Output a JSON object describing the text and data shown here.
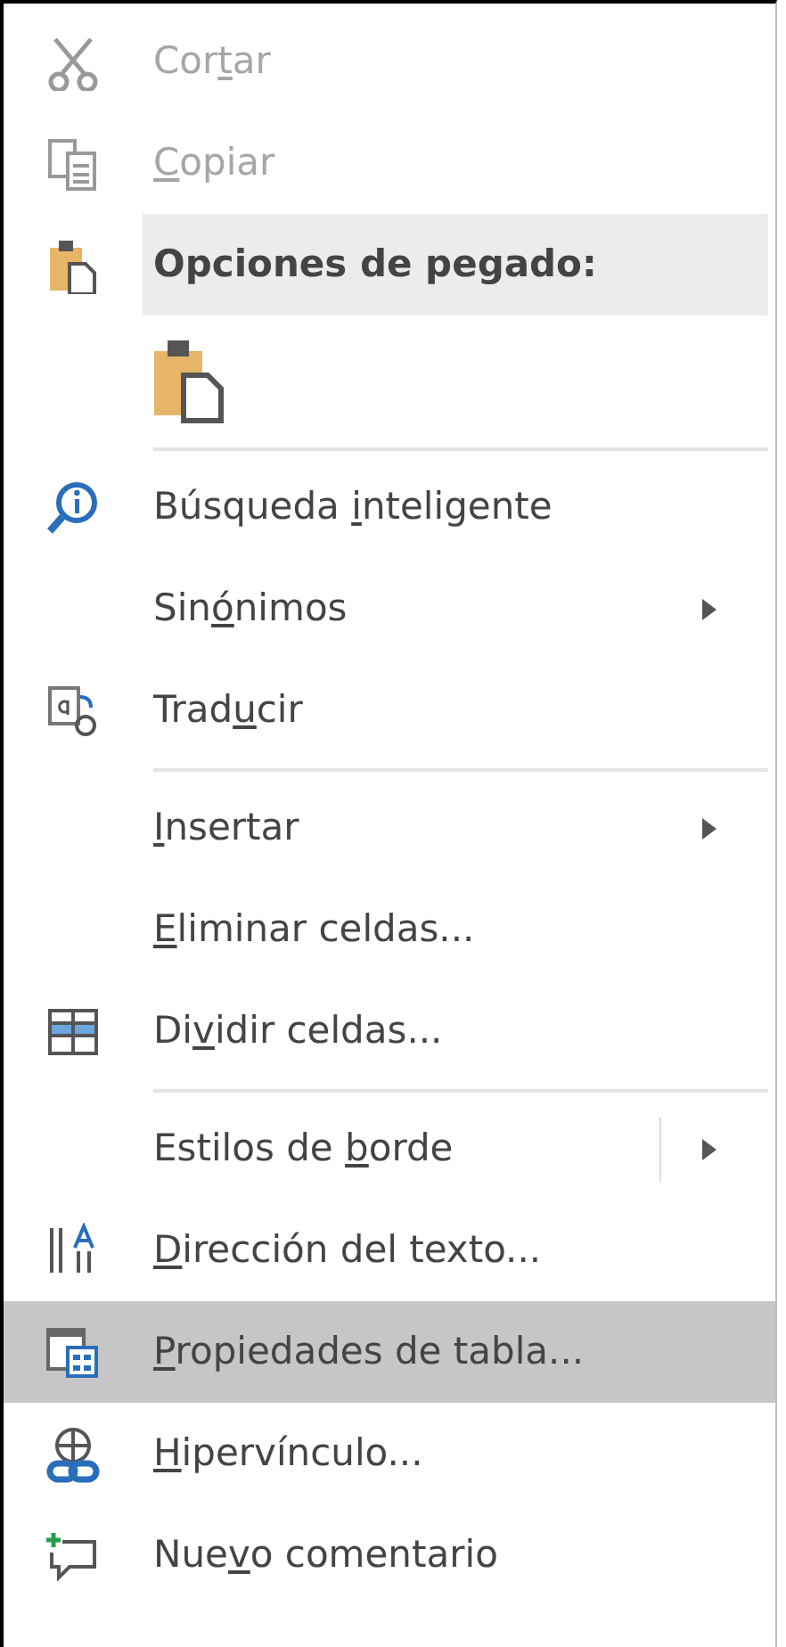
{
  "menu": {
    "items": [
      {
        "kind": "item",
        "label": {
          "before": "Cor",
          "key": "t",
          "after": "ar"
        },
        "disabled": true,
        "selected": false
      },
      {
        "kind": "item",
        "label": {
          "key": "C",
          "after": "opiar"
        },
        "disabled": true,
        "selected": false
      },
      {
        "kind": "header",
        "label": {
          "before": "Opciones de pegado:"
        }
      },
      {
        "kind": "paste_options"
      },
      {
        "kind": "separator"
      },
      {
        "kind": "item",
        "label": {
          "before": "Búsqueda ",
          "key": "i",
          "after": "nteligente"
        },
        "disabled": false,
        "selected": false
      },
      {
        "kind": "item",
        "label": {
          "before": "Sin",
          "key": "ó",
          "after": "nimos"
        },
        "disabled": false,
        "selected": false,
        "submenu": true
      },
      {
        "kind": "item",
        "label": {
          "before": "Trad",
          "key": "u",
          "after": "cir"
        },
        "disabled": false,
        "selected": false
      },
      {
        "kind": "separator"
      },
      {
        "kind": "item",
        "label": {
          "key": "I",
          "after": "nsertar"
        },
        "disabled": false,
        "selected": false,
        "submenu": true
      },
      {
        "kind": "item",
        "label": {
          "key": "E",
          "after": "liminar celdas..."
        },
        "disabled": false,
        "selected": false
      },
      {
        "kind": "item",
        "label": {
          "before": "Di",
          "key": "v",
          "after": "idir celdas..."
        },
        "disabled": false,
        "selected": false
      },
      {
        "kind": "separator"
      },
      {
        "kind": "item",
        "label": {
          "before": "Estilos de ",
          "key": "b",
          "after": "orde"
        },
        "disabled": false,
        "selected": false,
        "submenu": true,
        "split": true
      },
      {
        "kind": "item",
        "label": {
          "key": "D",
          "after": "irección del texto..."
        },
        "disabled": false,
        "selected": false
      },
      {
        "kind": "item",
        "label": {
          "key": "P",
          "after": "ropiedades de tabla..."
        },
        "disabled": false,
        "selected": true
      },
      {
        "kind": "item",
        "label": {
          "key": "H",
          "after": "ipervínculo..."
        },
        "disabled": false,
        "selected": false
      },
      {
        "kind": "item",
        "label": {
          "before": "Nue",
          "key": "v",
          "after": "o comentario"
        },
        "disabled": false,
        "selected": false
      }
    ]
  }
}
